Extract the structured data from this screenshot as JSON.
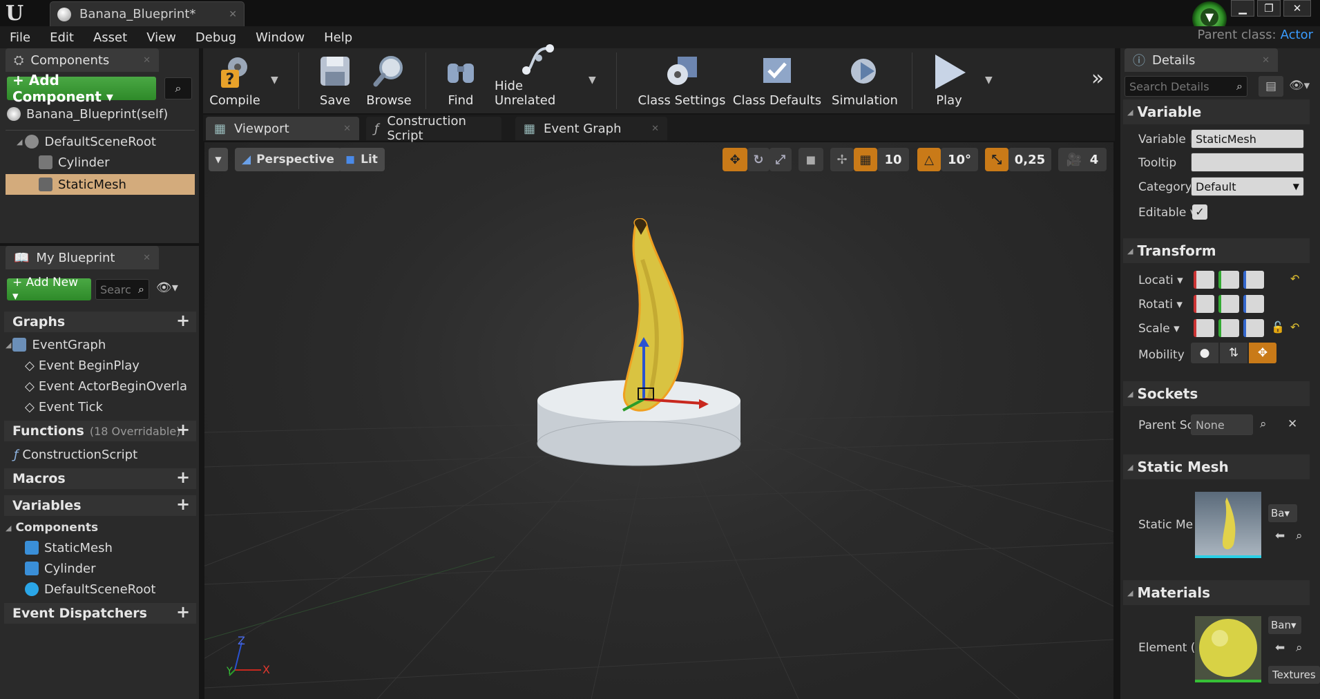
{
  "app": {
    "logo": "U",
    "tab_title": "Banana_Blueprint*",
    "parent_class_label": "Parent class:",
    "parent_class_value": "Actor"
  },
  "menu": [
    "File",
    "Edit",
    "Asset",
    "View",
    "Debug",
    "Window",
    "Help"
  ],
  "components_panel": {
    "title": "Components",
    "add_component_label": "+ Add Component ▾",
    "self_label": "Banana_Blueprint(self)",
    "tree": [
      "DefaultSceneRoot",
      "Cylinder",
      "StaticMesh"
    ]
  },
  "my_blueprint": {
    "title": "My Blueprint",
    "add_new_label": "+ Add New ▾",
    "search_placeholder": "Searc",
    "graphs_header": "Graphs",
    "event_graph": "EventGraph",
    "events": [
      "Event BeginPlay",
      "Event ActorBeginOverla",
      "Event Tick"
    ],
    "functions_header": "Functions",
    "functions_note": "(18 Overridable)",
    "construction_script": "ConstructionScript",
    "macros_header": "Macros",
    "variables_header": "Variables",
    "components_sub": "Components",
    "component_vars": [
      "StaticMesh",
      "Cylinder",
      "DefaultSceneRoot"
    ],
    "dispatchers_header": "Event Dispatchers"
  },
  "toolbar": {
    "compile": "Compile",
    "save": "Save",
    "browse": "Browse",
    "find": "Find",
    "hide_unrelated": "Hide Unrelated",
    "class_settings": "Class Settings",
    "class_defaults": "Class Defaults",
    "simulation": "Simulation",
    "play": "Play"
  },
  "editor_tabs": [
    "Viewport",
    "Construction Script",
    "Event Graph"
  ],
  "viewport": {
    "perspective": "Perspective",
    "lit": "Lit",
    "grid_snap": "10",
    "rotation_snap": "10°",
    "scale_snap": "0,25",
    "camera_speed": "4",
    "axis_x": "X",
    "axis_y": "Y",
    "axis_z": "Z"
  },
  "details": {
    "title": "Details",
    "search_placeholder": "Search Details",
    "variable_header": "Variable",
    "variable_name_label": "Variable I",
    "variable_name_value": "StaticMesh",
    "tooltip_label": "Tooltip",
    "category_label": "Category",
    "category_value": "Default",
    "editable_label": "Editable v",
    "transform_header": "Transform",
    "location_label": "Locati ▾",
    "rotation_label": "Rotati ▾",
    "scale_label": "Scale ▾",
    "mobility_label": "Mobility",
    "sockets_header": "Sockets",
    "parent_socket_label": "Parent Sc",
    "parent_socket_value": "None",
    "static_mesh_header": "Static Mesh",
    "static_mesh_label": "Static Me",
    "static_mesh_combo": "Ba▾",
    "materials_header": "Materials",
    "element_label": "Element (",
    "material_combo": "Ban▾",
    "textures_label": "Textures"
  },
  "colors": {
    "accent_orange": "#c97a18",
    "selection": "#d3ab7c",
    "green_button": "#3e9a38",
    "link_blue": "#3a9cff"
  }
}
